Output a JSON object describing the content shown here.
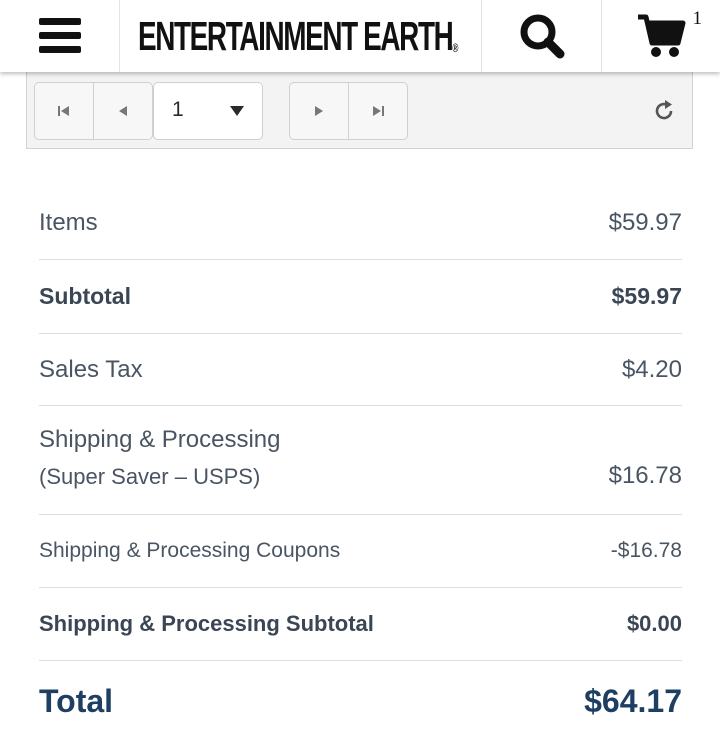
{
  "header": {
    "logo_text": "ENTERTAINMENT EARTH",
    "logo_reg": "®",
    "cart_count": "1",
    "icons": {
      "menu": "hamburger-menu-icon",
      "search": "search-icon",
      "cart": "shopping-cart-icon"
    }
  },
  "pager": {
    "current_page": "1",
    "icons": {
      "first": "first-page-icon",
      "prev": "previous-page-icon",
      "next": "next-page-icon",
      "last": "last-page-icon",
      "refresh": "refresh-icon"
    }
  },
  "summary": {
    "items_label": "Items",
    "items_value": "$59.97",
    "subtotal_label": "Subtotal",
    "subtotal_value": "$59.97",
    "tax_label": "Sales Tax",
    "tax_value": "$4.20",
    "shipping_label": "Shipping & Processing",
    "shipping_method": "(Super Saver – USPS)",
    "shipping_value": "$16.78",
    "coupons_label": "Shipping & Processing Coupons",
    "coupons_value": "-$16.78",
    "ship_subtotal_label": "Shipping & Processing Subtotal",
    "ship_subtotal_value": "$0.00",
    "total_label": "Total",
    "total_value": "$64.17"
  },
  "colors": {
    "text": "#4a5563",
    "total": "#1e3f62",
    "divider": "#dedede",
    "pager_bg": "#f3f3f3"
  }
}
